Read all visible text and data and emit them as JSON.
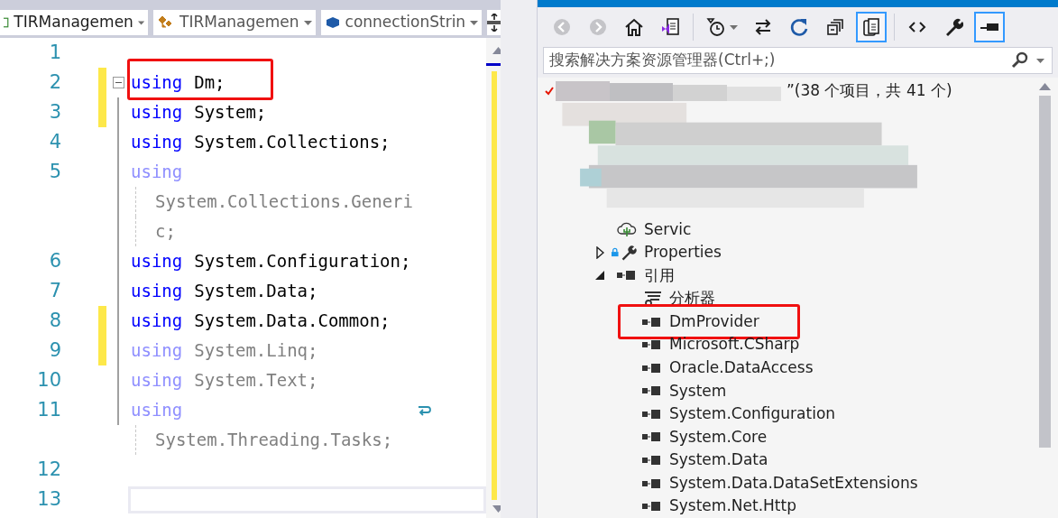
{
  "editor": {
    "nav": [
      {
        "label": "TIRManagemen",
        "kind": "project"
      },
      {
        "label": "TIRManagemen",
        "kind": "class"
      },
      {
        "label": "connectionStrin",
        "kind": "field"
      }
    ],
    "lines": [
      {
        "number": "1",
        "changed": false,
        "highlighted": false
      },
      {
        "number": "2",
        "keyword": "using",
        "text": "Dm;",
        "faded": false,
        "changed": true,
        "highlighted": true,
        "fold": true
      },
      {
        "number": "3",
        "keyword": "using",
        "text": "System;",
        "faded": false,
        "changed": true,
        "highlighted": false
      },
      {
        "number": "4",
        "keyword": "using",
        "text": "System.Collections;",
        "faded": false,
        "changed": false,
        "highlighted": false
      },
      {
        "number": "5",
        "keyword": "using",
        "faded": true,
        "changed": false,
        "highlighted": false,
        "wrapped": [
          "System.Collections.Generi",
          "c;"
        ]
      },
      {
        "number": "6",
        "keyword": "using",
        "text": "System.Configuration;",
        "faded": false,
        "changed": false,
        "highlighted": false
      },
      {
        "number": "7",
        "keyword": "using",
        "text": "System.Data;",
        "faded": false,
        "changed": false,
        "highlighted": false
      },
      {
        "number": "8",
        "keyword": "using",
        "text": "System.Data.Common;",
        "faded": false,
        "changed": true,
        "highlighted": false
      },
      {
        "number": "9",
        "keyword": "using",
        "text": "System.Linq;",
        "faded": true,
        "changed": true,
        "highlighted": false
      },
      {
        "number": "10",
        "keyword": "using",
        "text": "System.Text;",
        "faded": true,
        "changed": false,
        "highlighted": false
      },
      {
        "number": "11",
        "keyword": "using",
        "faded": true,
        "changed": false,
        "highlighted": false,
        "wrapped": [
          "System.Threading.Tasks;"
        ]
      },
      {
        "number": "12",
        "changed": false,
        "highlighted": false
      },
      {
        "number": "13",
        "changed": false,
        "highlighted": false,
        "current": true
      }
    ]
  },
  "solution_explorer": {
    "toolbar": [
      {
        "kind": "back",
        "disabled": true,
        "selected": false
      },
      {
        "kind": "forward",
        "disabled": true,
        "selected": false
      },
      {
        "kind": "home",
        "disabled": false,
        "selected": false
      },
      {
        "kind": "vsfile",
        "disabled": false,
        "selected": false
      },
      {
        "kind": "history",
        "disabled": false,
        "selected": false
      },
      {
        "kind": "sync",
        "disabled": false,
        "selected": false
      },
      {
        "kind": "refresh",
        "disabled": false,
        "selected": false
      },
      {
        "kind": "collapse",
        "disabled": false,
        "selected": false
      },
      {
        "kind": "copy",
        "disabled": false,
        "selected": true
      },
      {
        "kind": "code",
        "disabled": false,
        "selected": false
      },
      {
        "kind": "wrench",
        "disabled": false,
        "selected": false
      },
      {
        "kind": "pin",
        "disabled": false,
        "selected": true
      }
    ],
    "search": {
      "placeholder": "搜索解决方案资源管理器(Ctrl+;)"
    },
    "solution": {
      "label": "”(38 个项目，共 41 个)"
    },
    "project_items": [
      {
        "label": "Servic",
        "kind": "service",
        "highlighted": false
      },
      {
        "label": "Properties",
        "kind": "properties",
        "expanded": false,
        "highlighted": false
      },
      {
        "label": "引用",
        "kind": "references",
        "expanded": true,
        "highlighted": false,
        "children": [
          {
            "label": "分析器",
            "kind": "analyzer",
            "highlighted": false
          },
          {
            "label": "DmProvider",
            "kind": "assembly",
            "highlighted": true
          },
          {
            "label": "Microsoft.CSharp",
            "kind": "assembly",
            "highlighted": false
          },
          {
            "label": "Oracle.DataAccess",
            "kind": "assembly",
            "highlighted": false
          },
          {
            "label": "System",
            "kind": "assembly",
            "highlighted": false
          },
          {
            "label": "System.Configuration",
            "kind": "assembly",
            "highlighted": false
          },
          {
            "label": "System.Core",
            "kind": "assembly",
            "highlighted": false
          },
          {
            "label": "System.Data",
            "kind": "assembly",
            "highlighted": false
          },
          {
            "label": "System.Data.DataSetExtensions",
            "kind": "assembly",
            "highlighted": false
          },
          {
            "label": "System.Net.Http",
            "kind": "assembly",
            "highlighted": false
          }
        ]
      }
    ]
  }
}
